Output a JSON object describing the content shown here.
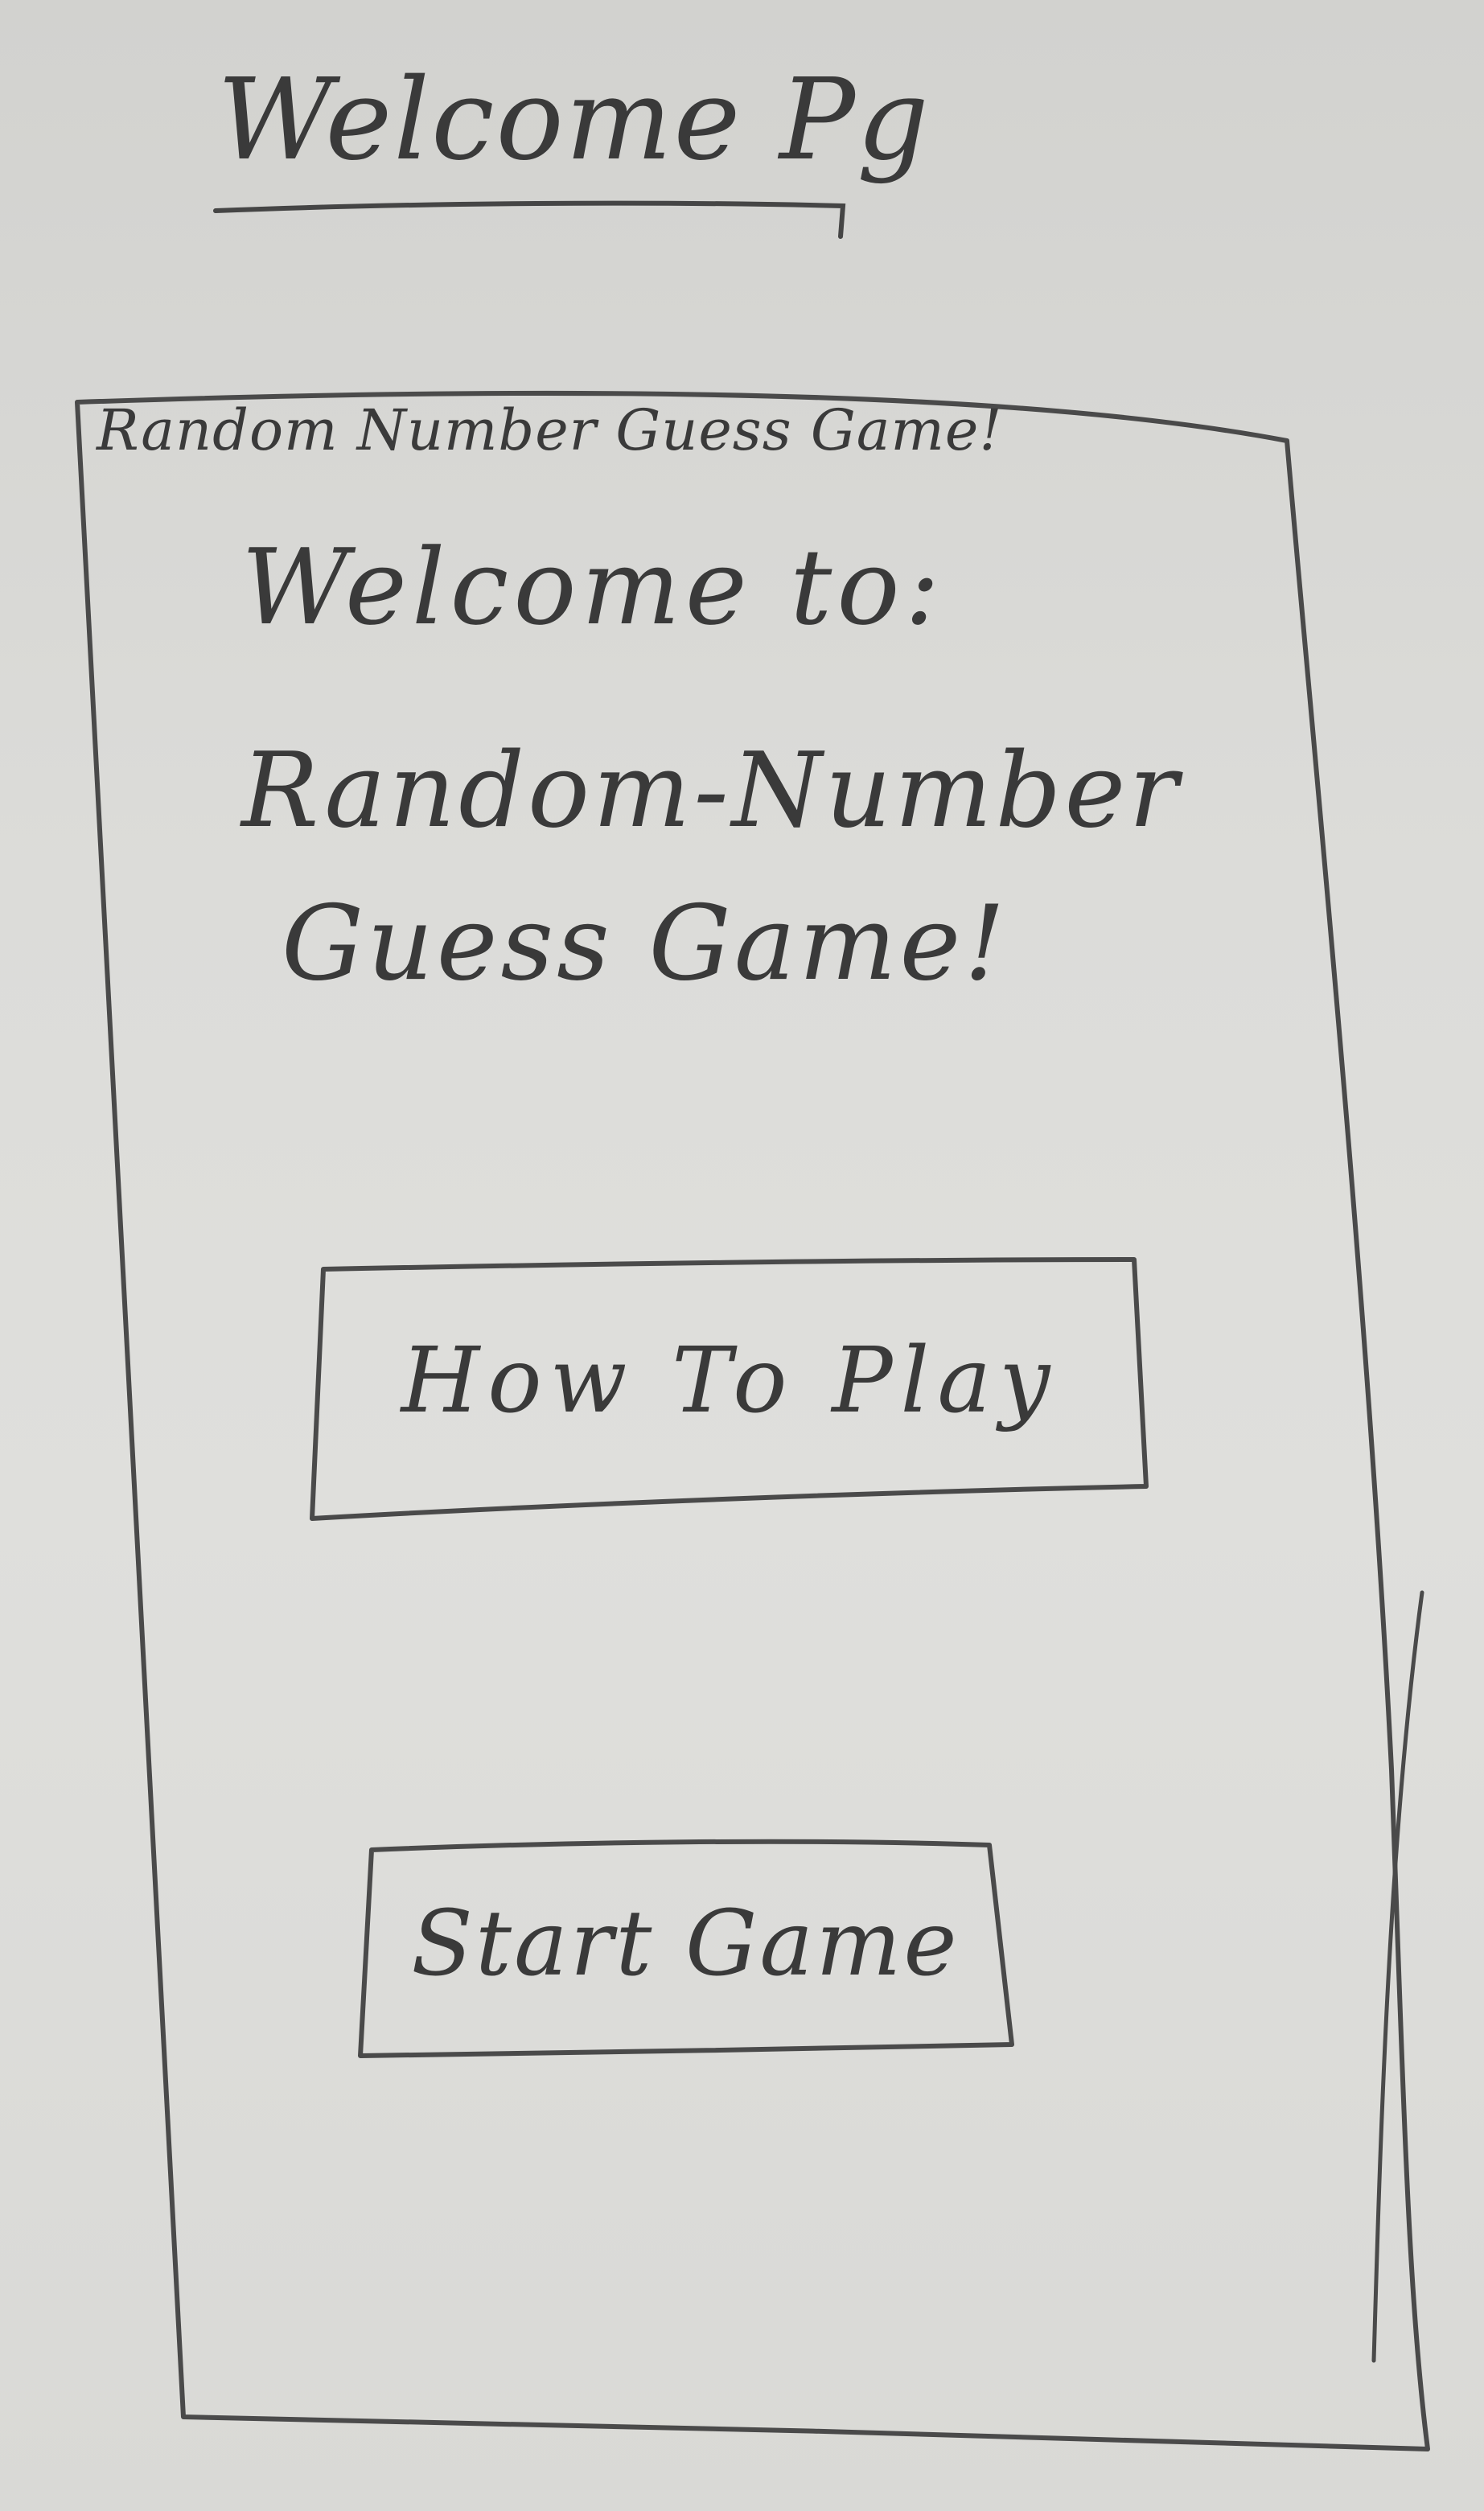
{
  "page": {
    "heading": "Welcome Pg"
  },
  "window": {
    "title": "Random Number Guess Game!"
  },
  "welcome": {
    "line1": "Welcome to:",
    "game_name_line1": "Random-Number",
    "game_name_line2": "Guess Game!"
  },
  "buttons": {
    "how_to_play": "How To Play",
    "start_game": "Start Game"
  }
}
